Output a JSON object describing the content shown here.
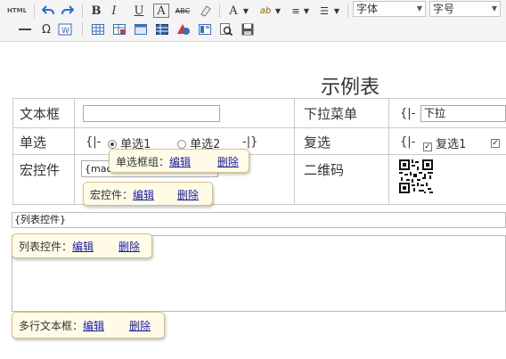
{
  "toolbar": {
    "html_label": "HTML",
    "bold": "B",
    "italic": "I",
    "underline": "U",
    "font_color": "A",
    "strike": "ABC",
    "font_select": "字体",
    "size_select": "字号"
  },
  "table": {
    "title": "示例表",
    "rows": [
      {
        "label": "文本框",
        "right_label": "下拉菜单"
      },
      {
        "label": "单选",
        "right_label": "复选"
      },
      {
        "label": "宏控件",
        "right_label": "二维码"
      }
    ],
    "dropdown_prefix": "{|-",
    "dropdown_value": "下拉",
    "radio_prefix": "{|-",
    "radio1": "单选1",
    "radio2": "单选2",
    "radio_suffix": "-|}",
    "check_prefix": "{|-",
    "check1": "复选1",
    "macro_value": "{mac"
  },
  "list_control": {
    "field": "{列表控件}"
  },
  "popups": {
    "radio_group": {
      "label": "单选框组：",
      "edit": "编辑",
      "delete": "删除"
    },
    "macro": {
      "label": "宏控件：",
      "edit": "编辑",
      "delete": "删除"
    },
    "list": {
      "label": "列表控件：",
      "edit": "编辑",
      "delete": "删除"
    },
    "textarea": {
      "label": "多行文本框：",
      "edit": "编辑",
      "delete": "删除"
    }
  }
}
